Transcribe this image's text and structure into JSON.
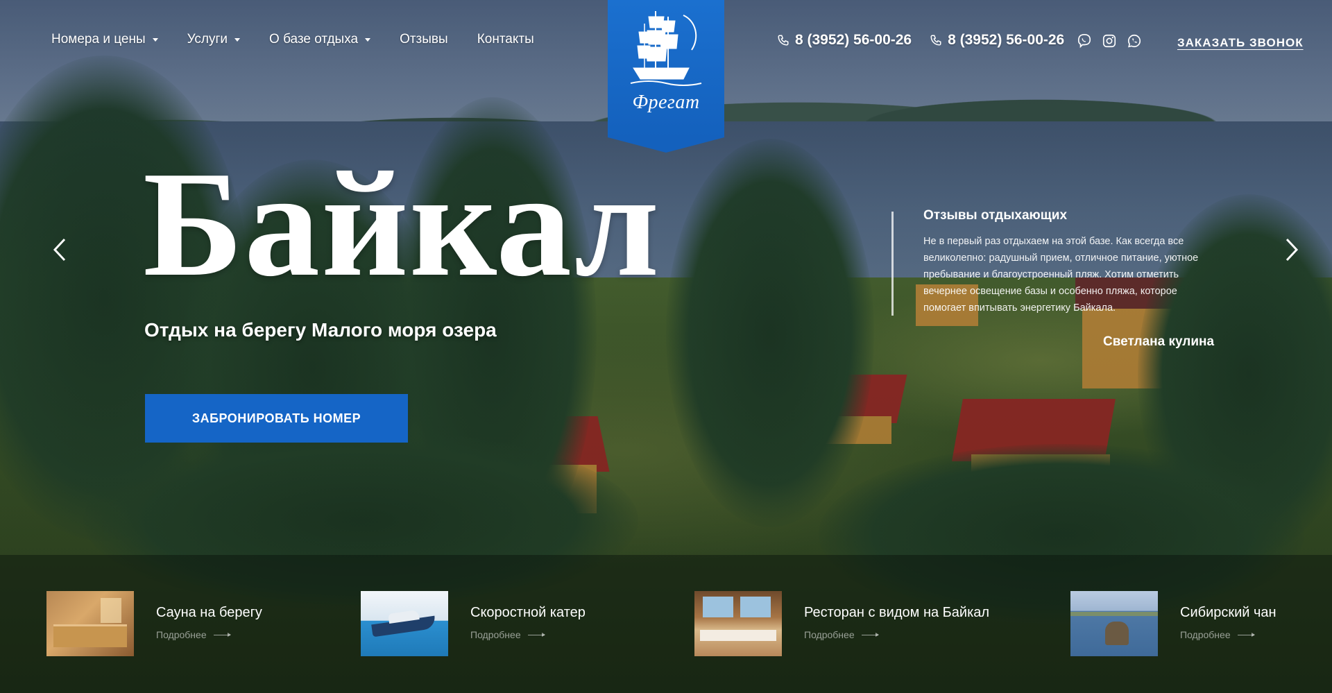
{
  "nav": {
    "items": [
      {
        "label": "Номера и цены",
        "dropdown": true
      },
      {
        "label": "Услуги",
        "dropdown": true
      },
      {
        "label": "О базе отдыха",
        "dropdown": true
      },
      {
        "label": "Отзывы",
        "dropdown": false
      },
      {
        "label": "Контакты",
        "dropdown": false
      }
    ]
  },
  "logo": {
    "text": "Фрегат"
  },
  "contacts": {
    "phones": [
      "8 (3952) 56-00-26",
      "8 (3952) 56-00-26"
    ],
    "social_icons": [
      "viber-icon",
      "instagram-icon",
      "whatsapp-icon"
    ],
    "callback_label": "ЗАКАЗАТЬ ЗВОНОК"
  },
  "hero": {
    "title": "Байкал",
    "subtitle": "Отдых на берегу Малого моря озера",
    "book_button": "ЗАБРОНИРОВАТЬ НОМЕР"
  },
  "slider": {
    "prev_icon": "chevron-left-icon",
    "next_icon": "chevron-right-icon"
  },
  "review": {
    "title": "Отзывы отдыхающих",
    "text": "Не в первый раз отдыхаем на этой базе. Как всегда все великолепно: радушный прием, отличное питание, уютное пребывание и благоустроенный пляж. Хотим отметить вечернее освещение базы и особенно пляжа, которое помогает впитывать энергетику Байкала.",
    "author": "Светлана кулина"
  },
  "services": [
    {
      "title": "Сауна на берегу",
      "more": "Подробнее"
    },
    {
      "title": "Скоростной катер",
      "more": "Подробнее"
    },
    {
      "title": "Ресторан с видом на Байкал",
      "more": "Подробнее"
    },
    {
      "title": "Сибирский чан",
      "more": "Подробнее"
    }
  ],
  "colors": {
    "accent": "#1565c6",
    "logo_bg": "#1b70cf",
    "text": "#ffffff"
  }
}
